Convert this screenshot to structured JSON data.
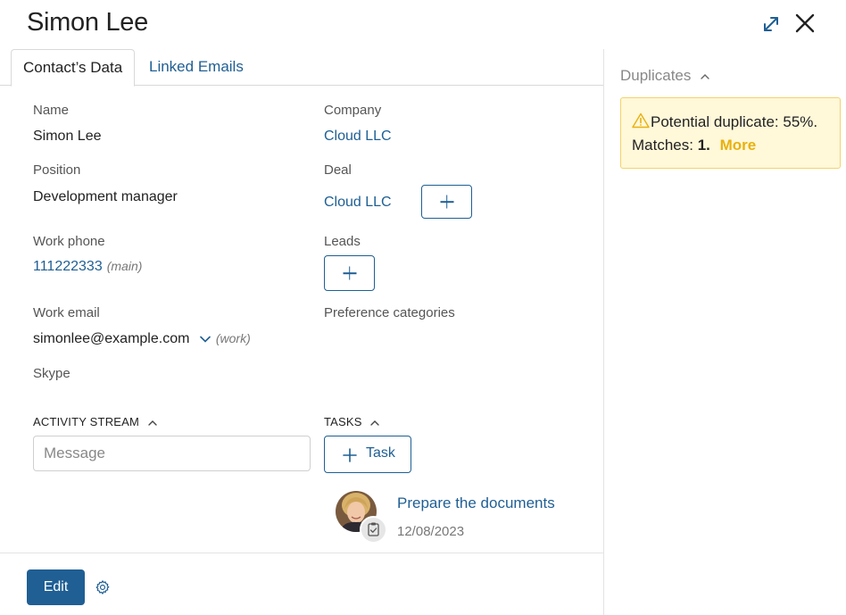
{
  "header": {
    "title": "Simon Lee"
  },
  "tabs": [
    {
      "label": "Contact’s Data"
    },
    {
      "label": "Linked Emails"
    }
  ],
  "left_fields": {
    "name": {
      "label": "Name",
      "value": "Simon Lee"
    },
    "position": {
      "label": "Position",
      "value": "Development manager"
    },
    "work_phone": {
      "label": "Work phone",
      "value": "111222333",
      "hint": "(main)"
    },
    "work_email": {
      "label": "Work email",
      "value": "simonlee@example.com",
      "hint": "(work)"
    },
    "skype": {
      "label": "Skype"
    }
  },
  "right_fields": {
    "company": {
      "label": "Company",
      "value": "Cloud LLC"
    },
    "deal": {
      "label": "Deal",
      "value": "Cloud LLC"
    },
    "leads": {
      "label": "Leads"
    },
    "preference": {
      "label": "Preference categories"
    }
  },
  "activity": {
    "title": "ACTIVITY STREAM",
    "placeholder": "Message"
  },
  "tasks": {
    "title": "TASKS",
    "add_label": "Task",
    "items": [
      {
        "title": "Prepare the documents",
        "date": "12/08/2023"
      }
    ]
  },
  "footer": {
    "edit_label": "Edit"
  },
  "duplicates": {
    "title": "Duplicates",
    "line1": "Potential duplicate: 55%.",
    "matches_label": "Matches:",
    "matches_count": "1.",
    "more_label": "More"
  },
  "colors": {
    "accent": "#1f5f94",
    "warning_bg": "#fff8d9",
    "warning_border": "#f2d36b",
    "more": "#e8b10e"
  }
}
